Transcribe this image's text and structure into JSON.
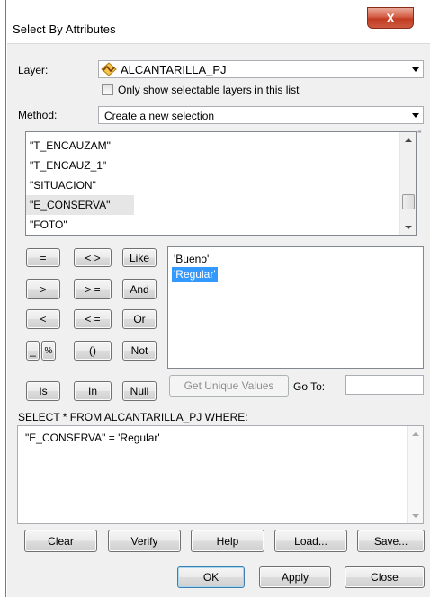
{
  "window": {
    "title": "Select By Attributes",
    "close_glyph": "X"
  },
  "layer": {
    "label": "Layer:",
    "value": "ALCANTARILLA_PJ",
    "icon": "polyline-layer-icon",
    "only_selectable_label": "Only show selectable layers in this list",
    "only_selectable_checked": false
  },
  "method": {
    "label": "Method:",
    "value": "Create a new selection"
  },
  "fields": {
    "items": [
      "\"T_ENCAUZAM\"",
      "\"T_ENCAUZ_1\"",
      "\"SITUACION\"",
      "\"E_CONSERVA\"",
      "\"FOTO\""
    ],
    "highlighted_index": 3,
    "scroll_position": 0.95
  },
  "operators": {
    "eq": "=",
    "neq": "< >",
    "like": "Like",
    "gt": ">",
    "gte": "> =",
    "and": "And",
    "lt": "<",
    "lte": "< =",
    "or": "Or",
    "underscore": "_",
    "percent": "%",
    "parens": "()",
    "not": "Not",
    "is": "Is",
    "in": "In",
    "null": "Null"
  },
  "values": {
    "items": [
      "'Bueno'",
      "'Regular'"
    ],
    "selected_index": 1
  },
  "unique": {
    "button": "Get Unique Values",
    "goto_label": "Go To:",
    "goto_value": ""
  },
  "query": {
    "prefix": "SELECT * FROM ALCANTARILLA_PJ WHERE:",
    "expression": "\"E_CONSERVA\" = 'Regular'"
  },
  "actions": {
    "clear": "Clear",
    "verify": "Verify",
    "help": "Help",
    "load": "Load...",
    "save": "Save..."
  },
  "dialog": {
    "ok": "OK",
    "apply": "Apply",
    "close": "Close"
  },
  "colors": {
    "selection": "#3399ff",
    "close_button": "#c8432b",
    "dialog_bg": "#f0f0f0"
  }
}
